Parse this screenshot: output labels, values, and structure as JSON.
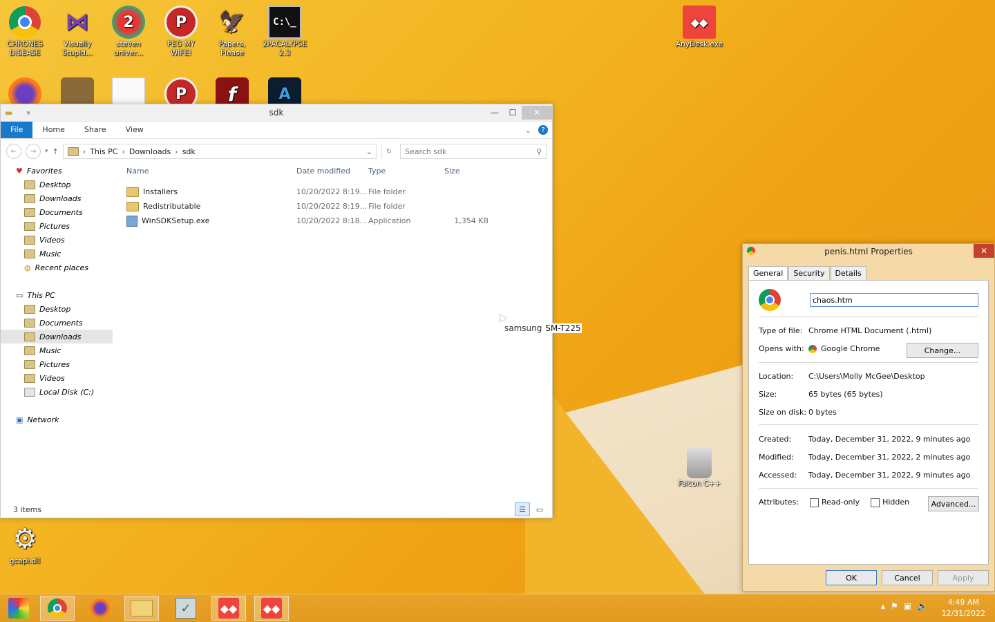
{
  "desktop": {
    "icons_row1": [
      {
        "label": "CHRONES DISEASE",
        "icon": "chrome-icon"
      },
      {
        "label": "Visually Stupid...",
        "icon": "visual-studio-icon"
      },
      {
        "label": "steven univer...",
        "icon": "steven-universe-icon"
      },
      {
        "label": "PEG MY WIFE!",
        "icon": "pegasus-icon"
      },
      {
        "label": "Papers, Please",
        "icon": "papers-please-icon"
      },
      {
        "label": "2PACALYPSE 2.3",
        "icon": "cmd-icon"
      }
    ],
    "anydesk_label": "AnyDesk.exe",
    "falcon_label": "Falcon C++",
    "gcapi_label": "gcapi.dll",
    "cmd_glyph": "C:\\_",
    "tooltip_text": "samsung",
    "tooltip_highlight": "SM-T225"
  },
  "explorer": {
    "title": "sdk",
    "ribbon_tabs": [
      "File",
      "Home",
      "Share",
      "View"
    ],
    "breadcrumb": [
      "This PC",
      "Downloads",
      "sdk"
    ],
    "search_placeholder": "Search sdk",
    "favorites_label": "Favorites",
    "favorites": [
      "Desktop",
      "Downloads",
      "Documents",
      "Pictures",
      "Videos",
      "Music",
      "Recent places"
    ],
    "thispc_label": "This PC",
    "thispc": [
      "Desktop",
      "Documents",
      "Downloads",
      "Music",
      "Pictures",
      "Videos",
      "Local Disk (C:)"
    ],
    "network_label": "Network",
    "columns": [
      "Name",
      "Date modified",
      "Type",
      "Size"
    ],
    "rows": [
      {
        "name": "Installers",
        "date": "10/20/2022 8:19...",
        "type": "File folder",
        "size": ""
      },
      {
        "name": "Redistributable",
        "date": "10/20/2022 8:19...",
        "type": "File folder",
        "size": ""
      },
      {
        "name": "WinSDKSetup.exe",
        "date": "10/20/2022 8:18...",
        "type": "Application",
        "size": "1,354 KB"
      }
    ],
    "status": "3 items"
  },
  "props": {
    "title": "penis.html Properties",
    "tabs": [
      "General",
      "Security",
      "Details"
    ],
    "filename_value": "chaos.htm",
    "type_k": "Type of file:",
    "type_v": "Chrome HTML Document (.html)",
    "opens_k": "Opens with:",
    "opens_v": "Google Chrome",
    "change_btn": "Change...",
    "location_k": "Location:",
    "location_v": "C:\\Users\\Molly McGee\\Desktop",
    "size_k": "Size:",
    "size_v": "65 bytes (65 bytes)",
    "disk_k": "Size on disk:",
    "disk_v": "0 bytes",
    "created_k": "Created:",
    "created_v": "Today, December 31, 2022, 9 minutes ago",
    "modified_k": "Modified:",
    "modified_v": "Today, December 31, 2022, 2 minutes ago",
    "accessed_k": "Accessed:",
    "accessed_v": "Today, December 31, 2022, 9 minutes ago",
    "attr_k": "Attributes:",
    "readonly": "Read-only",
    "hidden": "Hidden",
    "advanced_btn": "Advanced...",
    "ok": "OK",
    "cancel": "Cancel",
    "apply": "Apply"
  },
  "taskbar": {
    "time": "4:49 AM",
    "date": "12/31/2022",
    "anydesk_glyph": "◆◆"
  }
}
